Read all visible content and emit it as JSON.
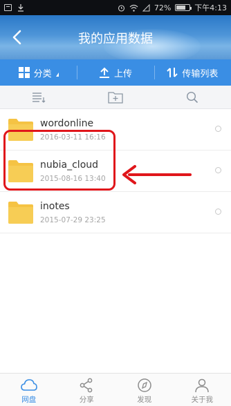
{
  "status_bar": {
    "battery": "72%",
    "time": "下午4:13",
    "battery_level": 0.72
  },
  "header": {
    "title": "我的应用数据"
  },
  "toolbar": {
    "category": "分类",
    "upload": "上传",
    "transfer": "传输列表"
  },
  "files": [
    {
      "name": "wordonline",
      "date": "2016-03-11  16:16"
    },
    {
      "name": "nubia_cloud",
      "date": "2015-08-16  13:40"
    },
    {
      "name": "inotes",
      "date": "2015-07-29  23:25"
    }
  ],
  "tabbar": {
    "tabs": [
      {
        "label": "网盘"
      },
      {
        "label": "分享"
      },
      {
        "label": "发现"
      },
      {
        "label": "关于我"
      }
    ]
  },
  "colors": {
    "accent": "#3a8ee4",
    "annotation": "#e0161b",
    "folder": "#f5c344"
  }
}
